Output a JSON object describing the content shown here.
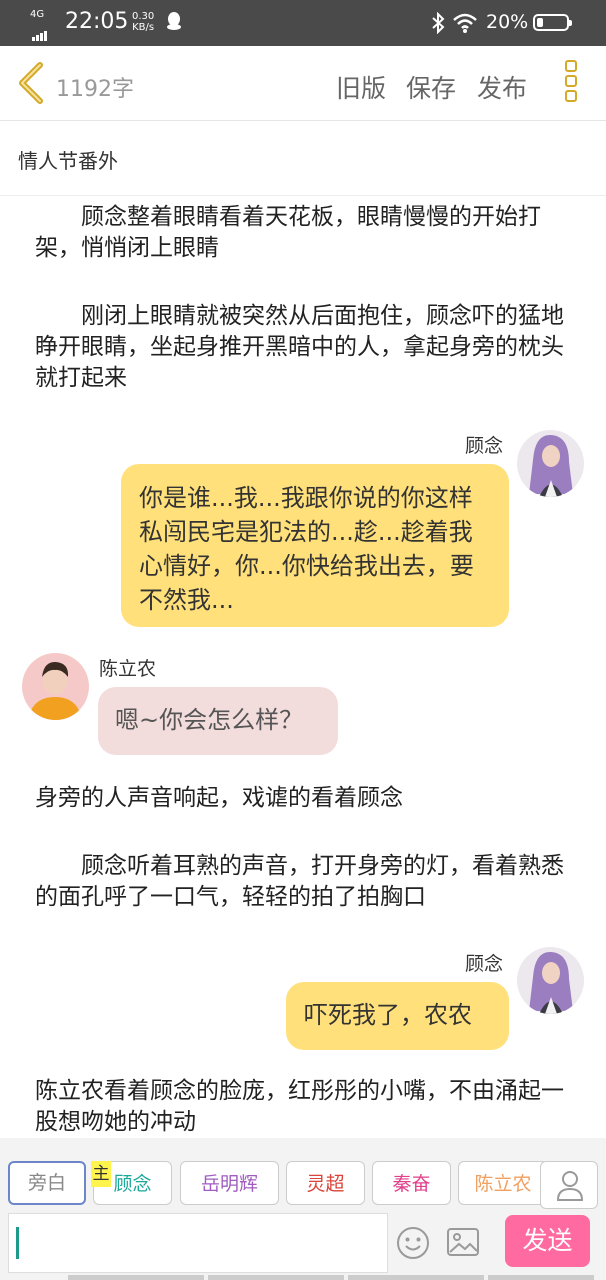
{
  "status_bar": {
    "network": "4G",
    "time": "22:05",
    "speed_value": "0.30",
    "speed_unit": "KB/s",
    "battery_text": "20%",
    "battery_level": 0.2,
    "icons": [
      "signal-icon",
      "qq-icon",
      "bluetooth-icon",
      "wifi-icon",
      "battery-icon"
    ]
  },
  "toolbar": {
    "word_count": "1192字",
    "old_version": "旧版",
    "save": "保存",
    "publish": "发布",
    "accent_color": "#d4a928"
  },
  "chapter_title": "情人节番外",
  "story": {
    "para1": "　　顾念整着眼睛看着天花板，眼睛慢慢的开始打架，悄悄闭上眼睛",
    "para2": "　　刚闭上眼睛就被突然从后面抱住，顾念吓的猛地睁开眼睛，坐起身推开黑暗中的人，拿起身旁的枕头就打起来",
    "msg1_name": "顾念",
    "msg1_text": "你是谁...我...我跟你说的你这样私闯民宅是犯法的...趁...趁着我心情好，你...你快给我出去，要不然我...",
    "msg2_name": "陈立农",
    "msg2_text": "嗯~你会怎么样？",
    "para3": "身旁的人声音响起，戏谑的看着顾念",
    "para4": "　　顾念听着耳熟的声音，打开身旁的灯，看着熟悉的面孔呼了一口气，轻轻的拍了拍胸口",
    "msg3_name": "顾念",
    "msg3_text": "吓死我了，农农",
    "para5": "陈立农看着顾念的脸庞，红彤彤的小嘴，不由涌起一股想吻她的冲动"
  },
  "characters": {
    "main_badge": "主",
    "items": [
      {
        "label": "旁白",
        "color": "#888888"
      },
      {
        "label": "顾念",
        "color": "#1aa89a"
      },
      {
        "label": "岳明辉",
        "color": "#a05cc0"
      },
      {
        "label": "灵超",
        "color": "#d9453a"
      },
      {
        "label": "秦奋",
        "color": "#e0408c"
      },
      {
        "label": "陈立农",
        "color": "#f0a060"
      }
    ]
  },
  "input": {
    "value": "",
    "send": "发送",
    "send_color": "#ff6aa0"
  },
  "colors": {
    "my_bubble": "#ffe07a",
    "other_bubble": "#f3dcdc"
  }
}
